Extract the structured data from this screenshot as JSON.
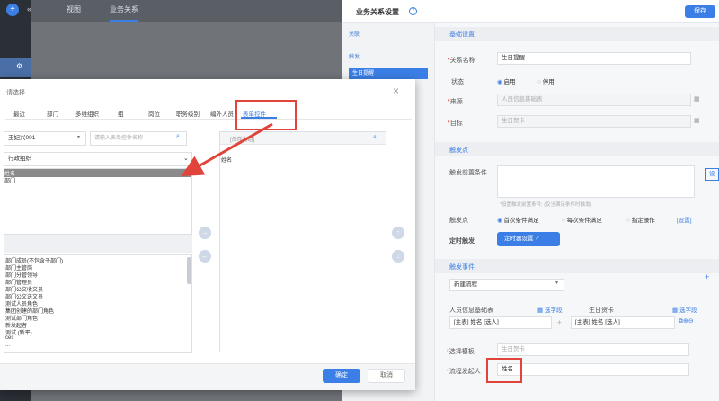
{
  "topnav": {
    "tab_view": "视图",
    "tab_relation": "业务关系"
  },
  "right_header": {
    "title": "业务关系设置",
    "save": "保存"
  },
  "side": {
    "item_relation": "关联",
    "item_trigger": "触发",
    "item_active": "生日提醒"
  },
  "basic": {
    "section": "基础设置",
    "name_label": "关系名称",
    "name_value": "生日提醒",
    "status_label": "状态",
    "status_on": "启用",
    "status_off": "停用",
    "source_label": "来源",
    "source_value": "人员信息基础表",
    "target_label": "目标",
    "target_value": "生日贺卡"
  },
  "trigger": {
    "section": "触发点",
    "pre_cond_label": "触发前置条件",
    "pre_cond_btn": "设",
    "pre_cond_hint": "*设置触发前置条件;  (仅当满足条件时触发)",
    "point_label": "触发点",
    "opt1": "首次条件满足",
    "opt2": "每次条件满足",
    "opt3": "指定操作",
    "opt3_link": "[设置]",
    "timer_label": "定时触发",
    "timer_btn": "定时器设置"
  },
  "event": {
    "section": "触发事件",
    "type_value": "新建流程",
    "src_label": "人员信息基础表",
    "src_pick": "选字段",
    "dst_label": "生日贺卡",
    "dst_pick": "选字段",
    "src_map": "[主表] 姓名 [选人]",
    "dst_map": "[主表] 姓名 [选人]",
    "template_label": "选择模板",
    "template_value": "生日贺卡",
    "initiator_label": "流程发起人",
    "initiator_value": "姓名"
  },
  "dialog": {
    "title": "请选择",
    "tabs": [
      "最近",
      "部门",
      "多维组织",
      "组",
      "岗位",
      "职务级别",
      "编外人员",
      "表单控件"
    ],
    "user_select": "王妃兴001",
    "search_placeholder": "请输入表单控件名称",
    "org_select": "行政组织",
    "top_list": [
      "姓名",
      "部门"
    ],
    "bottom_list": [
      "部门成员(不包含子部门)",
      "部门主管岗",
      "部门分管领导",
      "部门管理员",
      "部门公文收文员",
      "部门公文送文员",
      "测试人员角色",
      "集团创建的部门角色",
      "测试部门角色",
      "新发起者",
      "测试 (新平)",
      "ces",
      "..."
    ],
    "right_placeholder": "[保存为组]",
    "right_list": [
      "姓名"
    ],
    "ok": "确定",
    "cancel": "取消"
  },
  "colors": {
    "accent": "#3b7fe6",
    "highlight": "#e0443a"
  }
}
